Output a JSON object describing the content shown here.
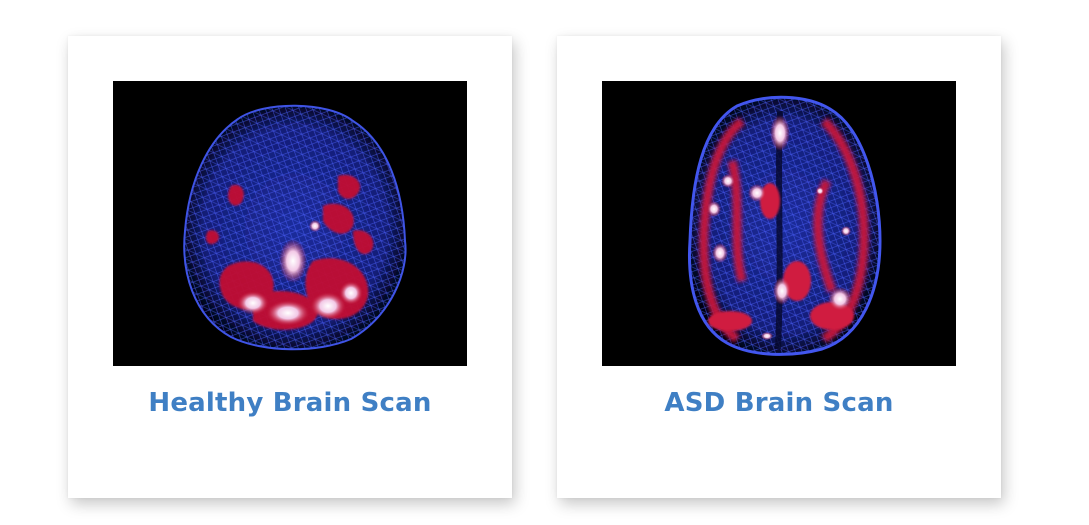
{
  "cards": [
    {
      "caption": "Healthy Brain Scan",
      "image": "healthy-brain-scan"
    },
    {
      "caption": "ASD Brain Scan",
      "image": "asd-brain-scan"
    }
  ],
  "colors": {
    "caption": "#3f7fc4",
    "scan_background": "#000000",
    "mesh": "#2a3ccc",
    "activity_low": "#c0102a",
    "activity_high": "#ffffff"
  }
}
